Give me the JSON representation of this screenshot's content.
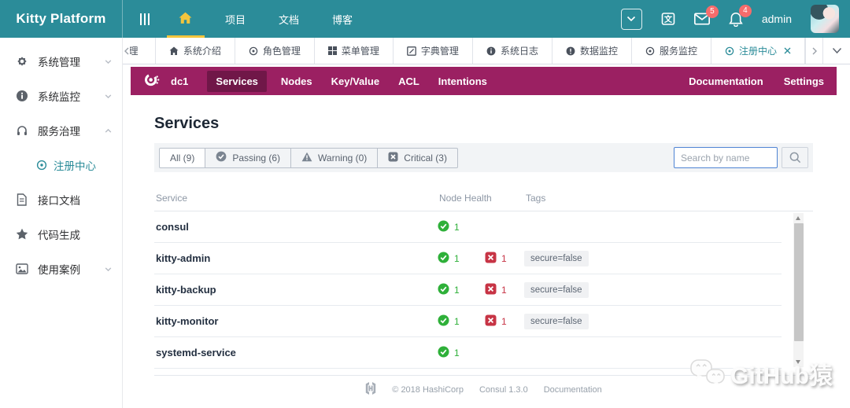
{
  "header": {
    "brand": "Kitty Platform",
    "nav": {
      "project": "项目",
      "docs": "文档",
      "blog": "博客"
    },
    "mail_badge": "5",
    "bell_badge": "4",
    "username": "admin"
  },
  "sidebar": {
    "items": [
      {
        "label": "系统管理",
        "icon": "gear-icon",
        "chevron": "down"
      },
      {
        "label": "系统监控",
        "icon": "info-icon",
        "chevron": "down"
      },
      {
        "label": "服务治理",
        "icon": "headset-icon",
        "chevron": "up",
        "expanded": true
      },
      {
        "label": "注册中心",
        "icon": "eye-icon",
        "submenu": true,
        "active": true
      },
      {
        "label": "接口文档",
        "icon": "document-icon"
      },
      {
        "label": "代码生成",
        "icon": "star-icon"
      },
      {
        "label": "使用案例",
        "icon": "image-icon",
        "chevron": "down"
      }
    ]
  },
  "tabs": {
    "items": [
      {
        "label": "管理",
        "partial": true
      },
      {
        "label": "系统介绍",
        "icon": "home-icon"
      },
      {
        "label": "角色管理",
        "icon": "eye-icon"
      },
      {
        "label": "菜单管理",
        "icon": "grid-icon"
      },
      {
        "label": "字典管理",
        "icon": "edit-icon"
      },
      {
        "label": "系统日志",
        "icon": "info-icon"
      },
      {
        "label": "数据监控",
        "icon": "warning-icon"
      },
      {
        "label": "服务监控",
        "icon": "eye-icon"
      },
      {
        "label": "注册中心",
        "icon": "eye-icon",
        "active": true,
        "closable": true
      }
    ]
  },
  "consul": {
    "nav": {
      "dc": "dc1",
      "items": [
        "Services",
        "Nodes",
        "Key/Value",
        "ACL",
        "Intentions"
      ],
      "active_item": "Services",
      "docs": "Documentation",
      "settings": "Settings"
    },
    "title": "Services",
    "filters": [
      {
        "label": "All (9)",
        "active": true
      },
      {
        "label": "Passing (6)",
        "icon": "check-circle-icon"
      },
      {
        "label": "Warning (0)",
        "icon": "warning-triangle-icon"
      },
      {
        "label": "Critical (3)",
        "icon": "critical-square-icon"
      }
    ],
    "search_placeholder": "Search by name",
    "table": {
      "columns": [
        "Service",
        "Node Health",
        "Tags"
      ],
      "rows": [
        {
          "name": "consul",
          "passing": "1",
          "critical": "",
          "tag": ""
        },
        {
          "name": "kitty-admin",
          "passing": "1",
          "critical": "1",
          "tag": "secure=false"
        },
        {
          "name": "kitty-backup",
          "passing": "1",
          "critical": "1",
          "tag": "secure=false"
        },
        {
          "name": "kitty-monitor",
          "passing": "1",
          "critical": "1",
          "tag": "secure=false"
        },
        {
          "name": "systemd-service",
          "passing": "1",
          "critical": "",
          "tag": ""
        }
      ]
    },
    "footer": {
      "copyright": "© 2018 HashiCorp",
      "version": "Consul 1.3.0",
      "doc": "Documentation"
    }
  },
  "watermark": {
    "text": "GitHub猿"
  },
  "colors": {
    "header_teal": "#2b8c99",
    "accent_yellow": "#f3c53d",
    "consul_magenta": "#9b2062",
    "consul_active": "#701748",
    "badge_red": "#f56c6c",
    "passing_green": "#2eb039",
    "critical_red": "#c73445",
    "search_focus_blue": "#4e83d3"
  }
}
